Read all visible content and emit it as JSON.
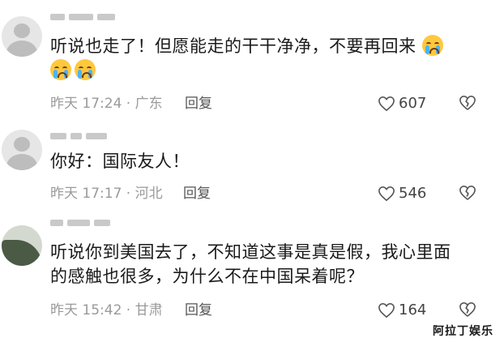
{
  "comments": [
    {
      "text": "听说也走了！但愿能走的干干净净，不要再回来",
      "emoji_after": [
        "crying-face-emoji",
        "crying-face-emoji",
        "crying-face-emoji"
      ],
      "meta": "昨天 17:24 · 广东",
      "reply": "回复",
      "likes": "607"
    },
    {
      "text": "你好：国际友人！",
      "meta": "昨天 17:17 · 河北",
      "reply": "回复",
      "likes": "546"
    },
    {
      "text_line1": "听说你到美国去了，不知道这事是真是假，我心里面",
      "text_line2": "的感触也很多，为什么不在中国呆着呢？",
      "meta": "昨天 15:42 · 甘肃",
      "reply": "回复",
      "likes": "164"
    }
  ],
  "watermark": "阿拉丁娱乐",
  "colors": {
    "meta": "#9a9a9a",
    "text": "#1a1a1a",
    "emoji": "#ffc83d"
  }
}
